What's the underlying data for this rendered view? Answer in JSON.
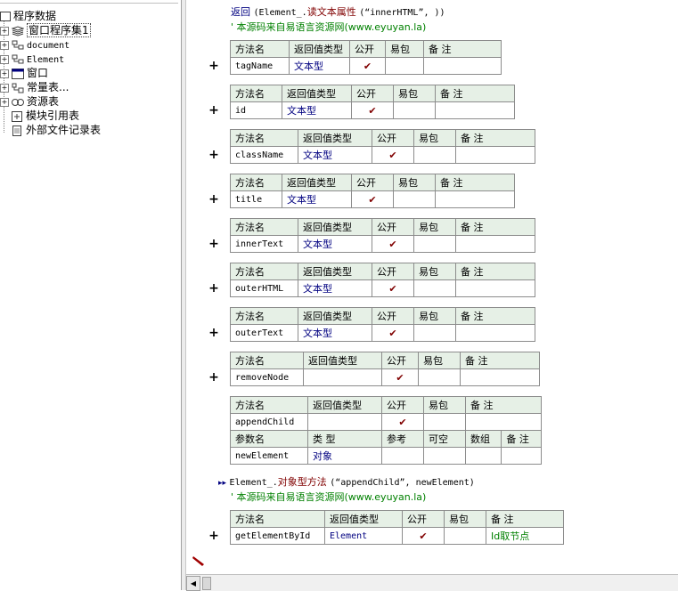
{
  "tree": {
    "root": "程序数据",
    "items": [
      {
        "label": "窗口程序集1",
        "mono": false
      },
      {
        "label": "document",
        "mono": true
      },
      {
        "label": "Element",
        "mono": true
      },
      {
        "label": "窗口",
        "mono": false
      },
      {
        "label": "常量表...",
        "mono": false
      },
      {
        "label": "资源表",
        "mono": false
      },
      {
        "label": "模块引用表",
        "mono": false
      },
      {
        "label": "外部文件记录表",
        "mono": false
      }
    ]
  },
  "code": {
    "return_kw": "返回",
    "return_obj": "(Element_.",
    "return_fn": "读文本属性",
    "return_args": "(“innerHTML”, ))",
    "comment1": "' 本源码来自易语言资源网(www.eyuyan.la)",
    "call_obj": "Element_.",
    "call_fn": "对象型方法",
    "call_args": "(“appendChild”, newElement)",
    "comment2": "' 本源码来自易语言资源网(www.eyuyan.la)",
    "check": "✔",
    "plus": "+"
  },
  "headers": {
    "method": "方法名",
    "ret": "返回值类型",
    "public": "公开",
    "easy": "易包",
    "note": "备 注",
    "param": "参数名",
    "type": "类 型",
    "ref": "参考",
    "nullable": "可空",
    "array": "数组"
  },
  "methods": [
    {
      "name": "tagName",
      "type": "文本型",
      "note": ""
    },
    {
      "name": "id",
      "type": "文本型",
      "note": ""
    },
    {
      "name": "className",
      "type": "文本型",
      "note": ""
    },
    {
      "name": "title",
      "type": "文本型",
      "note": ""
    },
    {
      "name": "innerText",
      "type": "文本型",
      "note": ""
    },
    {
      "name": "outerHTML",
      "type": "文本型",
      "note": ""
    },
    {
      "name": "outerText",
      "type": "文本型",
      "note": ""
    },
    {
      "name": "removeNode",
      "type": "",
      "note": ""
    },
    {
      "name": "appendChild",
      "type": "",
      "note": ""
    },
    {
      "name": "getElementById",
      "type": "Element",
      "note": "Id取节点"
    }
  ],
  "param": {
    "name": "newElement",
    "type": "对象"
  }
}
